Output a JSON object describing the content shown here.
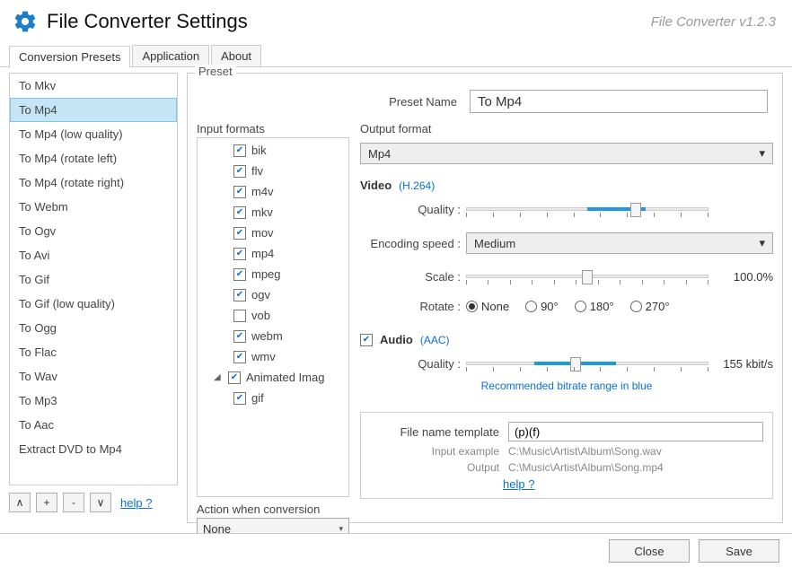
{
  "header": {
    "title": "File Converter Settings",
    "version": "File Converter v1.2.3"
  },
  "tabs": [
    "Conversion Presets",
    "Application",
    "About"
  ],
  "presets": [
    "To Mkv",
    "To Mp4",
    "To Mp4 (low quality)",
    "To Mp4 (rotate left)",
    "To Mp4 (rotate right)",
    "To Webm",
    "To Ogv",
    "To Avi",
    "To Gif",
    "To Gif (low quality)",
    "To Ogg",
    "To Flac",
    "To Wav",
    "To Mp3",
    "To Aac",
    "Extract DVD to Mp4"
  ],
  "selected_preset_index": 1,
  "sidebar_buttons": {
    "up": "∧",
    "add": "+",
    "remove": "-",
    "down": "∨"
  },
  "help_label": "help ?",
  "preset_section": {
    "label": "Preset",
    "name_label": "Preset Name",
    "name_value": "To Mp4"
  },
  "input_formats": {
    "label": "Input formats",
    "items": [
      {
        "label": "bik",
        "checked": true,
        "indent": true
      },
      {
        "label": "flv",
        "checked": true,
        "indent": true
      },
      {
        "label": "m4v",
        "checked": true,
        "indent": true
      },
      {
        "label": "mkv",
        "checked": true,
        "indent": true
      },
      {
        "label": "mov",
        "checked": true,
        "indent": true
      },
      {
        "label": "mp4",
        "checked": true,
        "indent": true
      },
      {
        "label": "mpeg",
        "checked": true,
        "indent": true
      },
      {
        "label": "ogv",
        "checked": true,
        "indent": true
      },
      {
        "label": "vob",
        "checked": false,
        "indent": true
      },
      {
        "label": "webm",
        "checked": true,
        "indent": true
      },
      {
        "label": "wmv",
        "checked": true,
        "indent": true
      },
      {
        "label": "Animated Imag",
        "checked": true,
        "indent": false,
        "group": true
      },
      {
        "label": "gif",
        "checked": true,
        "indent": true
      }
    ]
  },
  "action": {
    "label": "Action when conversion",
    "value": "None"
  },
  "output": {
    "label": "Output format",
    "value": "Mp4",
    "video": {
      "title": "Video",
      "codec": "(H.264)",
      "quality_label": "Quality :",
      "quality_pct": 70,
      "enc_label": "Encoding speed :",
      "enc_value": "Medium",
      "scale_label": "Scale :",
      "scale_value": "100.0%",
      "scale_pct": 50,
      "rotate_label": "Rotate :",
      "rotate_options": [
        "None",
        "90°",
        "180°",
        "270°"
      ],
      "rotate_selected": 0
    },
    "audio": {
      "title": "Audio",
      "codec": "(AAC)",
      "checked": true,
      "quality_label": "Quality :",
      "quality_value": "155 kbit/s",
      "quality_pct": 45,
      "range_lo": 28,
      "range_hi": 62,
      "note": "Recommended bitrate range in blue"
    }
  },
  "templates": {
    "label": "File name template",
    "value": "(p)(f)",
    "input_example_label": "Input example",
    "input_example": "C:\\Music\\Artist\\Album\\Song.wav",
    "output_label": "Output",
    "output_value": "C:\\Music\\Artist\\Album\\Song.mp4"
  },
  "footer": {
    "close": "Close",
    "save": "Save"
  }
}
